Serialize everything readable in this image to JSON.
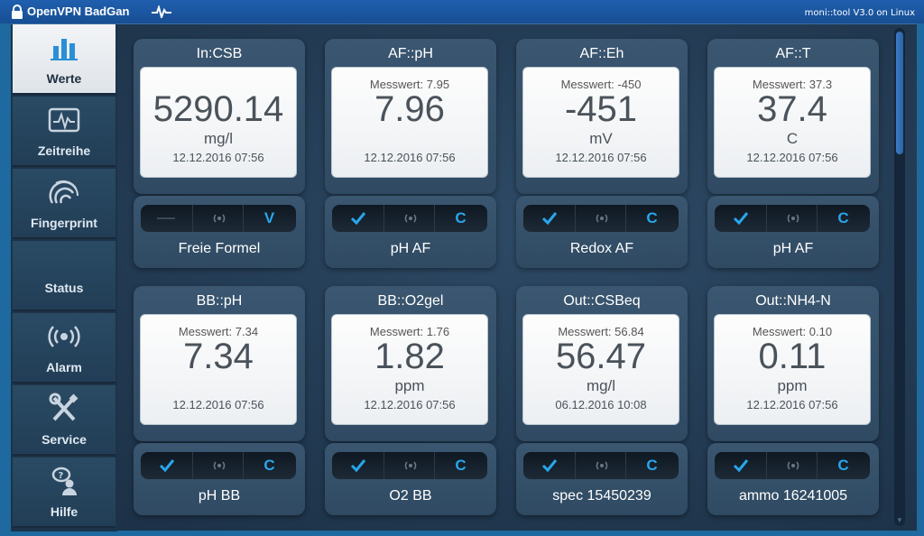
{
  "window": {
    "title": "OpenVPN BadGan",
    "right_text": "moni::tool V3.0 on Linux"
  },
  "sidebar": {
    "items": [
      {
        "label": "Werte",
        "icon": "bar-chart-icon",
        "active": true
      },
      {
        "label": "Zeitreihe",
        "icon": "waveform-monitor-icon",
        "active": false
      },
      {
        "label": "Fingerprint",
        "icon": "fingerprint-icon",
        "active": false
      },
      {
        "label": "Status",
        "icon": "",
        "active": false
      },
      {
        "label": "Alarm",
        "icon": "alarm-signal-icon",
        "active": false
      },
      {
        "label": "Service",
        "icon": "wrench-screwdriver-icon",
        "active": false
      },
      {
        "label": "Hilfe",
        "icon": "help-person-icon",
        "active": false
      }
    ]
  },
  "colors": {
    "accent": "#29a6ec",
    "titlebar": "#1f5fae",
    "panel_bg": "#2f4a62"
  },
  "cards": [
    {
      "title": "In:CSB",
      "messwert": "",
      "value": "5290.14",
      "unit": "mg/l",
      "timestamp": "12.12.2016 07:56",
      "name": "Freie Formel",
      "status_icon": "dash",
      "alarm_icon": "alarm-icon",
      "mode": "V"
    },
    {
      "title": "AF::pH",
      "messwert": "Messwert: 7.95",
      "value": "7.96",
      "unit": "",
      "timestamp": "12.12.2016 07:56",
      "name": "pH AF",
      "status_icon": "check",
      "alarm_icon": "alarm-icon",
      "mode": "C"
    },
    {
      "title": "AF::Eh",
      "messwert": "Messwert: -450",
      "value": "-451",
      "unit": "mV",
      "timestamp": "12.12.2016 07:56",
      "name": "Redox AF",
      "status_icon": "check",
      "alarm_icon": "alarm-icon",
      "mode": "C"
    },
    {
      "title": "AF::T",
      "messwert": "Messwert: 37.3",
      "value": "37.4",
      "unit": "C",
      "timestamp": "12.12.2016 07:56",
      "name": "pH AF",
      "status_icon": "check",
      "alarm_icon": "alarm-icon",
      "mode": "C"
    },
    {
      "title": "BB::pH",
      "messwert": "Messwert: 7.34",
      "value": "7.34",
      "unit": "",
      "timestamp": "12.12.2016 07:56",
      "name": "pH BB",
      "status_icon": "check",
      "alarm_icon": "alarm-icon",
      "mode": "C"
    },
    {
      "title": "BB::O2gel",
      "messwert": "Messwert: 1.76",
      "value": "1.82",
      "unit": "ppm",
      "timestamp": "12.12.2016 07:56",
      "name": "O2 BB",
      "status_icon": "check",
      "alarm_icon": "alarm-icon",
      "mode": "C"
    },
    {
      "title": "Out::CSBeq",
      "messwert": "Messwert: 56.84",
      "value": "56.47",
      "unit": "mg/l",
      "timestamp": "06.12.2016 10:08",
      "name": "spec 15450239",
      "status_icon": "check",
      "alarm_icon": "alarm-icon",
      "mode": "C"
    },
    {
      "title": "Out::NH4-N",
      "messwert": "Messwert: 0.10",
      "value": "0.11",
      "unit": "ppm",
      "timestamp": "12.12.2016 07:56",
      "name": "ammo 16241005",
      "status_icon": "check",
      "alarm_icon": "alarm-icon",
      "mode": "C"
    }
  ]
}
